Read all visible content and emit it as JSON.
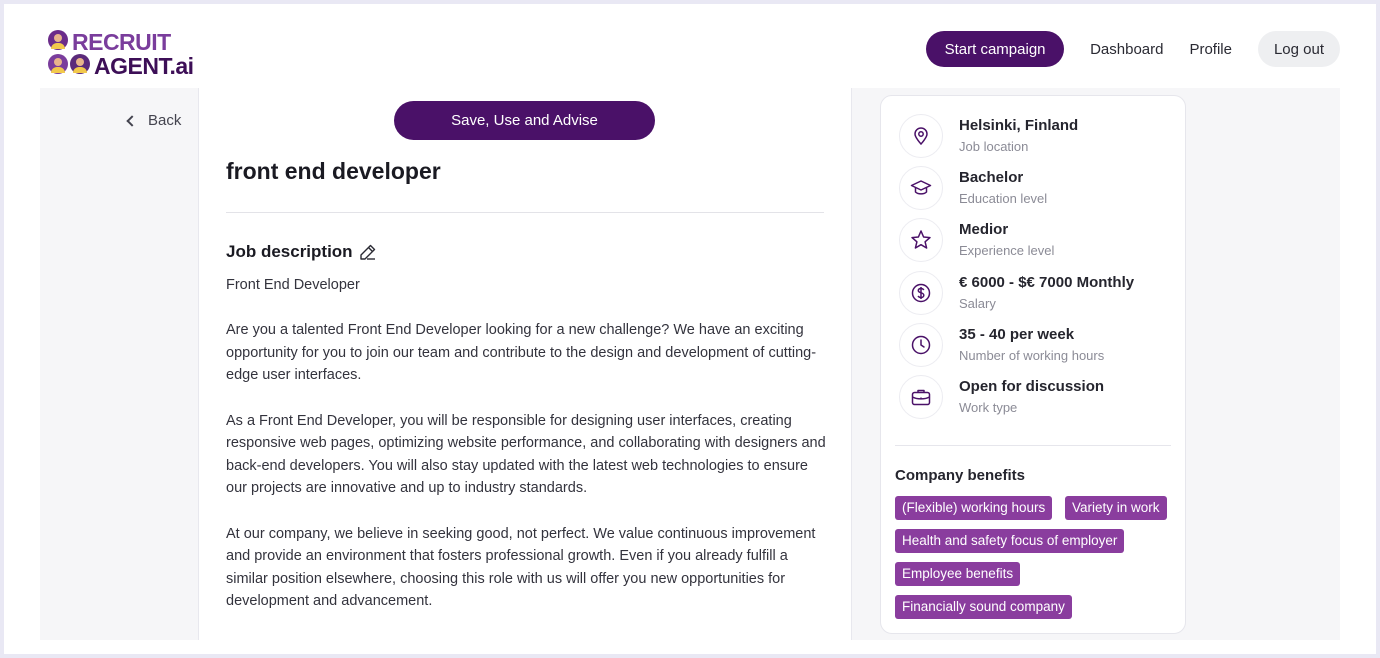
{
  "brand": {
    "line1": "RECRUIT",
    "line2": "AGENT",
    "line2_suffix": ".ai",
    "colors": {
      "primary": "#4a1168",
      "accent": "#8a3d9e"
    }
  },
  "nav": {
    "start_campaign": "Start campaign",
    "dashboard": "Dashboard",
    "profile": "Profile",
    "logout": "Log out"
  },
  "back_label": "Back",
  "save_button": "Save, Use and Advise",
  "job_title": "front end developer",
  "job_description": {
    "heading": "Job description",
    "paragraphs": [
      "Front End Developer",
      "Are you a talented Front End Developer looking for a new challenge? We have an exciting opportunity for you to join our team and contribute to the design and development of cutting-edge user interfaces.",
      "As a Front End Developer, you will be responsible for designing user interfaces, creating responsive web pages, optimizing website performance, and collaborating with designers and back-end developers. You will also stay updated with the latest web technologies to ensure our projects are innovative and up to industry standards.",
      "At our company, we believe in seeking good, not perfect. We value continuous improvement and provide an environment that fosters professional growth. Even if you already fulfill a similar position elsewhere, choosing this role with us will offer you new opportunities for development and advancement."
    ]
  },
  "facts": [
    {
      "icon": "location-pin-icon",
      "value": "Helsinki, Finland",
      "label": "Job location"
    },
    {
      "icon": "graduation-cap-icon",
      "value": "Bachelor",
      "label": "Education level"
    },
    {
      "icon": "star-icon",
      "value": "Medior",
      "label": "Experience level"
    },
    {
      "icon": "dollar-icon",
      "value": "€ 6000 - $€ 7000 Monthly",
      "label": "Salary"
    },
    {
      "icon": "clock-icon",
      "value": "35 - 40 per week",
      "label": "Number of working hours"
    },
    {
      "icon": "briefcase-icon",
      "value": "Open for discussion",
      "label": "Work type"
    }
  ],
  "benefits": {
    "title": "Company benefits",
    "tags": [
      "(Flexible) working hours",
      "Variety in work",
      "Health and safety focus of employer",
      "Employee benefits",
      "Financially sound company"
    ]
  }
}
